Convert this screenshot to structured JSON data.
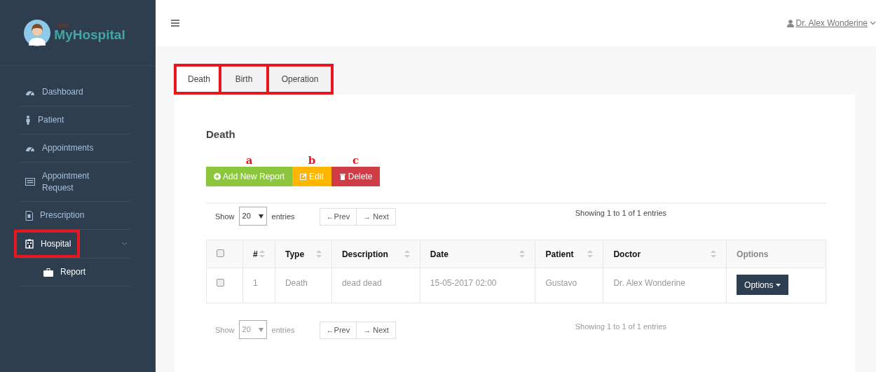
{
  "brand": {
    "small": "ERP",
    "name": "MyHospital"
  },
  "sidebar": {
    "items": [
      {
        "label": "Dashboard",
        "kind": "gauge",
        "selected": false,
        "highlighted": false
      },
      {
        "label": "Patient",
        "kind": "person",
        "selected": false,
        "highlighted": false
      },
      {
        "label": "Appointments",
        "kind": "gauge",
        "selected": false,
        "highlighted": false
      },
      {
        "label": "Appointment Request",
        "kind": "list",
        "selected": false,
        "highlighted": false
      },
      {
        "label": "Prescription",
        "kind": "document",
        "selected": false,
        "highlighted": false
      },
      {
        "label": "Hospital",
        "kind": "building",
        "selected": true,
        "highlighted": true,
        "expanded": true,
        "children": [
          {
            "label": "Report",
            "kind": "briefcase",
            "selected": true,
            "highlighted": false
          }
        ]
      }
    ]
  },
  "topbar": {
    "user": "Dr. Alex Wonderine"
  },
  "tabs": {
    "highlighted": true,
    "items": [
      {
        "label": "Death",
        "selected": true
      },
      {
        "label": "Birth",
        "selected": false
      },
      {
        "label": "Operation",
        "selected": false
      }
    ]
  },
  "panel": {
    "title": "Death",
    "buttons": [
      {
        "kind": "add",
        "label": "Add New Report",
        "annotation": "a"
      },
      {
        "kind": "edit",
        "label": "Edit",
        "annotation": "b"
      },
      {
        "kind": "delete",
        "label": "Delete",
        "annotation": "c"
      }
    ],
    "top_controls": {
      "show": "Show",
      "page_size": "20",
      "entries": "entries",
      "prev": "←Prev",
      "next": "→ Next",
      "info": "Showing 1 to 1 of 1 entries",
      "dim": false
    },
    "table": {
      "columns": [
        {
          "kind": "check",
          "checked": false
        },
        {
          "label": "#",
          "sortable": true
        },
        {
          "label": "Type",
          "sortable": true
        },
        {
          "label": "Description",
          "sortable": true
        },
        {
          "label": "Date",
          "sortable": true
        },
        {
          "label": "Patient",
          "sortable": true
        },
        {
          "label": "Doctor",
          "sortable": true
        },
        {
          "label": "Options",
          "sortable": false
        }
      ],
      "rows": [
        {
          "checked": false,
          "cells": [
            "",
            "1",
            "Death",
            "dead dead",
            "15-05-2017 02:00",
            "Gustavo",
            "Dr. Alex Wonderine"
          ],
          "action": "Options"
        }
      ]
    },
    "bottom_controls": {
      "show": "Show",
      "page_size": "20",
      "entries": "entries",
      "prev": "←Prev",
      "next": "→ Next",
      "info": "Showing 1 to 1 of 1 entries",
      "dim": true
    }
  }
}
